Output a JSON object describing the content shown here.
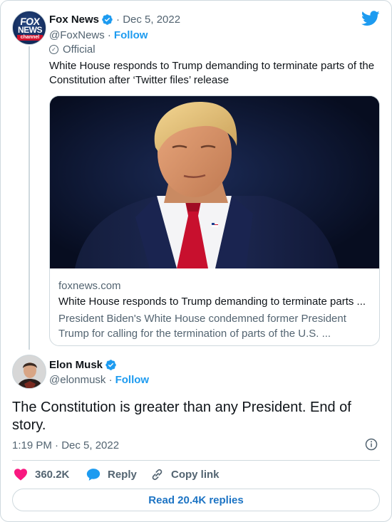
{
  "quoted_tweet": {
    "author_name": "Fox News",
    "date": "· Dec 5, 2022",
    "handle": "@FoxNews ·",
    "follow_label": "Follow",
    "official_label": "Official",
    "avatar_text_line1": "FOX",
    "avatar_text_line2": "NEWS",
    "avatar_text_line3": "channel",
    "text": "White House responds to Trump demanding to terminate parts of the Constitution after ‘Twitter files’ release",
    "link_card": {
      "domain": "foxnews.com",
      "title": "White House responds to Trump demanding to terminate parts ...",
      "description": "President Biden's White House condemned former President Trump for calling for the termination of parts of the U.S. ..."
    }
  },
  "main_tweet": {
    "author_name": "Elon Musk",
    "handle": "@elonmusk ·",
    "follow_label": "Follow",
    "text": "The Constitution is greater than any President. End of story.",
    "timestamp": "1:19 PM · Dec 5, 2022"
  },
  "actions": {
    "likes": "360.2K",
    "reply_label": "Reply",
    "copy_link_label": "Copy link"
  },
  "read_replies_label": "Read 20.4K replies",
  "colors": {
    "accent": "#1d9bf0",
    "like": "#f91880",
    "muted": "#536471",
    "border": "#cfd9de"
  },
  "icons": [
    "verified-badge-icon",
    "twitter-bird-icon",
    "official-ring-icon",
    "info-icon",
    "heart-icon",
    "reply-bubble-icon",
    "link-icon"
  ]
}
